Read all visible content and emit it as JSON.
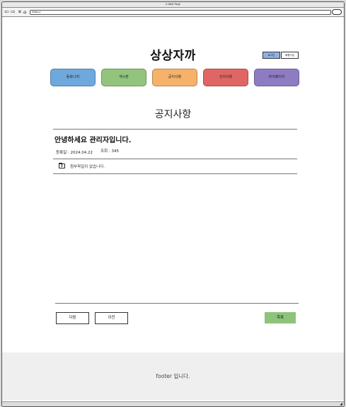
{
  "window": {
    "title": "A Web Page"
  },
  "browser": {
    "address": "https://",
    "icons": [
      "back-icon",
      "forward-icon",
      "close-icon",
      "home-icon",
      "search-icon"
    ]
  },
  "header": {
    "site_title": "상상자까",
    "auth": {
      "login_label": "로그인",
      "signup_label": "회원가입"
    }
  },
  "nav": {
    "items": [
      {
        "label": "동화나라",
        "color": "#6fa8dc"
      },
      {
        "label": "게시판",
        "color": "#93c47d"
      },
      {
        "label": "공지사항",
        "color": "#f6b26b"
      },
      {
        "label": "건의사항",
        "color": "#e06666"
      },
      {
        "label": "마이페이지",
        "color": "#8e7cc3"
      }
    ]
  },
  "notice": {
    "section_title": "공지사항",
    "post_title": "안녕하세요 관리자입니다.",
    "date_text": "등록일 : 2024.04.22",
    "views_text": "조회 : 345",
    "attachment_text": "첨부파일이 없습니다."
  },
  "actions": {
    "next_label": "다음",
    "prev_label": "이전",
    "list_label": "목록"
  },
  "footer": {
    "text": "footer 입니다."
  }
}
